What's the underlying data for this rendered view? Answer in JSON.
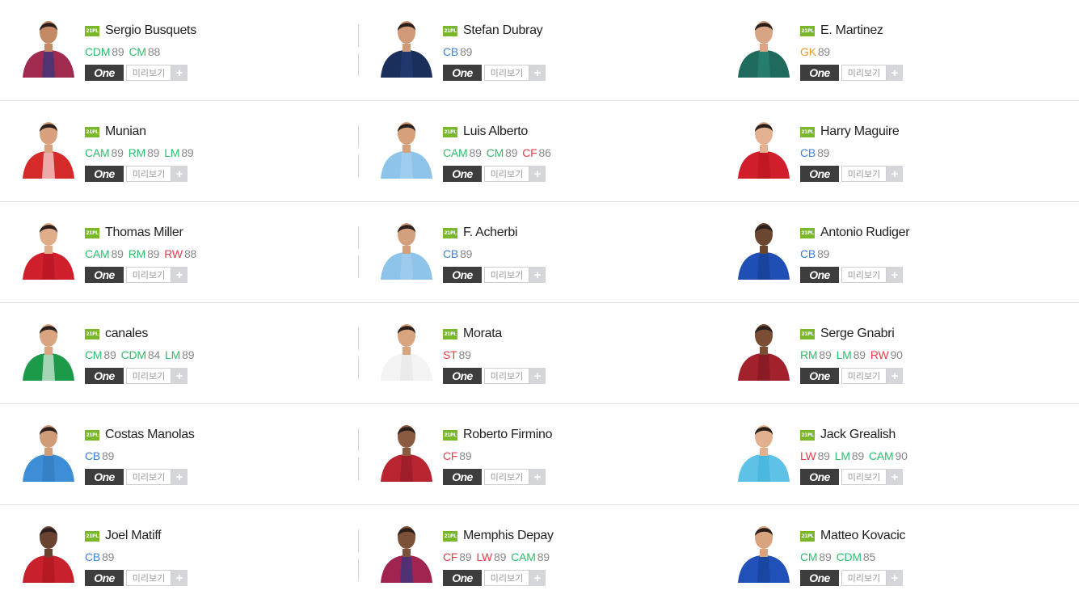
{
  "colors": {
    "pos_green": "#2cbf6c",
    "pos_blue": "#3b82d8",
    "pos_red": "#ea3b48",
    "pos_orange": "#f0992a",
    "badge": "#7ab72b",
    "one_button": "#3d3d3d"
  },
  "buttons": {
    "one_label": "One",
    "preview_label": "미리보기",
    "plus_label": "+"
  },
  "players": [
    {
      "season": "21PL",
      "name": "Sergio Busquets",
      "positions": [
        {
          "code": "CDM",
          "value": "89",
          "color": "green"
        },
        {
          "code": "CM",
          "value": "88",
          "color": "green"
        }
      ],
      "jersey": "#a12a4f",
      "jersey2": "#1d3b8a",
      "skin": "#c48a66"
    },
    {
      "season": "21PL",
      "name": "Stefan Dubray",
      "positions": [
        {
          "code": "CB",
          "value": "89",
          "color": "blue"
        }
      ],
      "jersey": "#1a2f5a",
      "jersey2": "#243f7a",
      "skin": "#d09a78"
    },
    {
      "season": "21PL",
      "name": "E. Martinez",
      "positions": [
        {
          "code": "GK",
          "value": "89",
          "color": "orange"
        }
      ],
      "jersey": "#1e6a5c",
      "jersey2": "#2b8a78",
      "skin": "#d7a584"
    },
    {
      "season": "21PL",
      "name": "Munian",
      "positions": [
        {
          "code": "CAM",
          "value": "89",
          "color": "green"
        },
        {
          "code": "RM",
          "value": "89",
          "color": "green"
        },
        {
          "code": "LM",
          "value": "89",
          "color": "green"
        }
      ],
      "jersey": "#d42a2a",
      "jersey2": "#ffffff",
      "skin": "#d8a07c"
    },
    {
      "season": "21PL",
      "name": "Luis Alberto",
      "positions": [
        {
          "code": "CAM",
          "value": "89",
          "color": "green"
        },
        {
          "code": "CM",
          "value": "89",
          "color": "green"
        },
        {
          "code": "CF",
          "value": "86",
          "color": "red"
        }
      ],
      "jersey": "#8fc4ea",
      "jersey2": "#a8d3f0",
      "skin": "#d6a07a"
    },
    {
      "season": "21PL",
      "name": "Harry Maguire",
      "positions": [
        {
          "code": "CB",
          "value": "89",
          "color": "blue"
        }
      ],
      "jersey": "#d01f2a",
      "jersey2": "#b8141e",
      "skin": "#e3b18f"
    },
    {
      "season": "21PL",
      "name": "Thomas Miller",
      "positions": [
        {
          "code": "CAM",
          "value": "89",
          "color": "green"
        },
        {
          "code": "RM",
          "value": "89",
          "color": "green"
        },
        {
          "code": "RW",
          "value": "88",
          "color": "red"
        }
      ],
      "jersey": "#d0202e",
      "jersey2": "#b3121f",
      "skin": "#e0ad8a"
    },
    {
      "season": "21PL",
      "name": "F. Acherbi",
      "positions": [
        {
          "code": "CB",
          "value": "89",
          "color": "blue"
        }
      ],
      "jersey": "#8ec3ea",
      "jersey2": "#a6d1f0",
      "skin": "#d3a07e"
    },
    {
      "season": "21PL",
      "name": "Antonio Rudiger",
      "positions": [
        {
          "code": "CB",
          "value": "89",
          "color": "blue"
        }
      ],
      "jersey": "#1f4fb4",
      "jersey2": "#163d90",
      "skin": "#6b4631"
    },
    {
      "season": "21PL",
      "name": "canales",
      "positions": [
        {
          "code": "CM",
          "value": "89",
          "color": "green"
        },
        {
          "code": "CDM",
          "value": "84",
          "color": "green"
        },
        {
          "code": "LM",
          "value": "89",
          "color": "green"
        }
      ],
      "jersey": "#1c9a4a",
      "jersey2": "#ffffff",
      "skin": "#d9a581"
    },
    {
      "season": "21PL",
      "name": "Morata",
      "positions": [
        {
          "code": "ST",
          "value": "89",
          "color": "red"
        }
      ],
      "jersey": "#f4f4f4",
      "jersey2": "#e4e4e4",
      "skin": "#d8a580"
    },
    {
      "season": "21PL",
      "name": "Serge Gnabri",
      "positions": [
        {
          "code": "RM",
          "value": "89",
          "color": "green"
        },
        {
          "code": "LM",
          "value": "89",
          "color": "green"
        },
        {
          "code": "RW",
          "value": "90",
          "color": "red"
        }
      ],
      "jersey": "#a3212c",
      "jersey2": "#7a1820",
      "skin": "#7a4d35"
    },
    {
      "season": "21PL",
      "name": "Costas Manolas",
      "positions": [
        {
          "code": "CB",
          "value": "89",
          "color": "blue"
        }
      ],
      "jersey": "#3d8ed6",
      "jersey2": "#2f78bd",
      "skin": "#d09c78"
    },
    {
      "season": "21PL",
      "name": "Roberto Firmino",
      "positions": [
        {
          "code": "CF",
          "value": "89",
          "color": "red"
        }
      ],
      "jersey": "#b82430",
      "jersey2": "#8e1a24",
      "skin": "#8a5b40"
    },
    {
      "season": "21PL",
      "name": "Jack Grealish",
      "positions": [
        {
          "code": "LW",
          "value": "89",
          "color": "red"
        },
        {
          "code": "LM",
          "value": "89",
          "color": "green"
        },
        {
          "code": "CAM",
          "value": "90",
          "color": "green"
        }
      ],
      "jersey": "#5ec2e6",
      "jersey2": "#3fb0dc",
      "skin": "#e1b08f"
    },
    {
      "season": "21PL",
      "name": "Joel Matiff",
      "positions": [
        {
          "code": "CB",
          "value": "89",
          "color": "blue"
        }
      ],
      "jersey": "#c8202c",
      "jersey2": "#a8151f",
      "skin": "#6a4330"
    },
    {
      "season": "21PL",
      "name": "Memphis Depay",
      "positions": [
        {
          "code": "CF",
          "value": "89",
          "color": "red"
        },
        {
          "code": "LW",
          "value": "89",
          "color": "red"
        },
        {
          "code": "CAM",
          "value": "89",
          "color": "green"
        }
      ],
      "jersey": "#a0244f",
      "jersey2": "#1b3a8c",
      "skin": "#7d5039"
    },
    {
      "season": "21PL",
      "name": "Matteo Kovacic",
      "positions": [
        {
          "code": "CM",
          "value": "89",
          "color": "green"
        },
        {
          "code": "CDM",
          "value": "85",
          "color": "green"
        }
      ],
      "jersey": "#2050b8",
      "jersey2": "#173f94",
      "skin": "#d8a47f"
    }
  ]
}
